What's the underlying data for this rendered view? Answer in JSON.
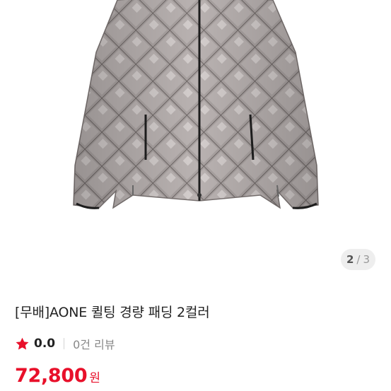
{
  "gallery": {
    "image_alt": "product photo: grey quilted lightweight padded jacket",
    "current": "2",
    "separator": "/",
    "total": "3"
  },
  "product": {
    "title": "[무배]AONE 퀼팅 경량 패딩 2컬러",
    "rating": "0.0",
    "review_count_text": "0건 리뷰",
    "price": "72,800",
    "currency": "원"
  },
  "colors": {
    "accent": "#e8102a",
    "star": "#e8102a",
    "jacket": "#a59d9c"
  },
  "icons": {
    "rating": "star-icon"
  }
}
